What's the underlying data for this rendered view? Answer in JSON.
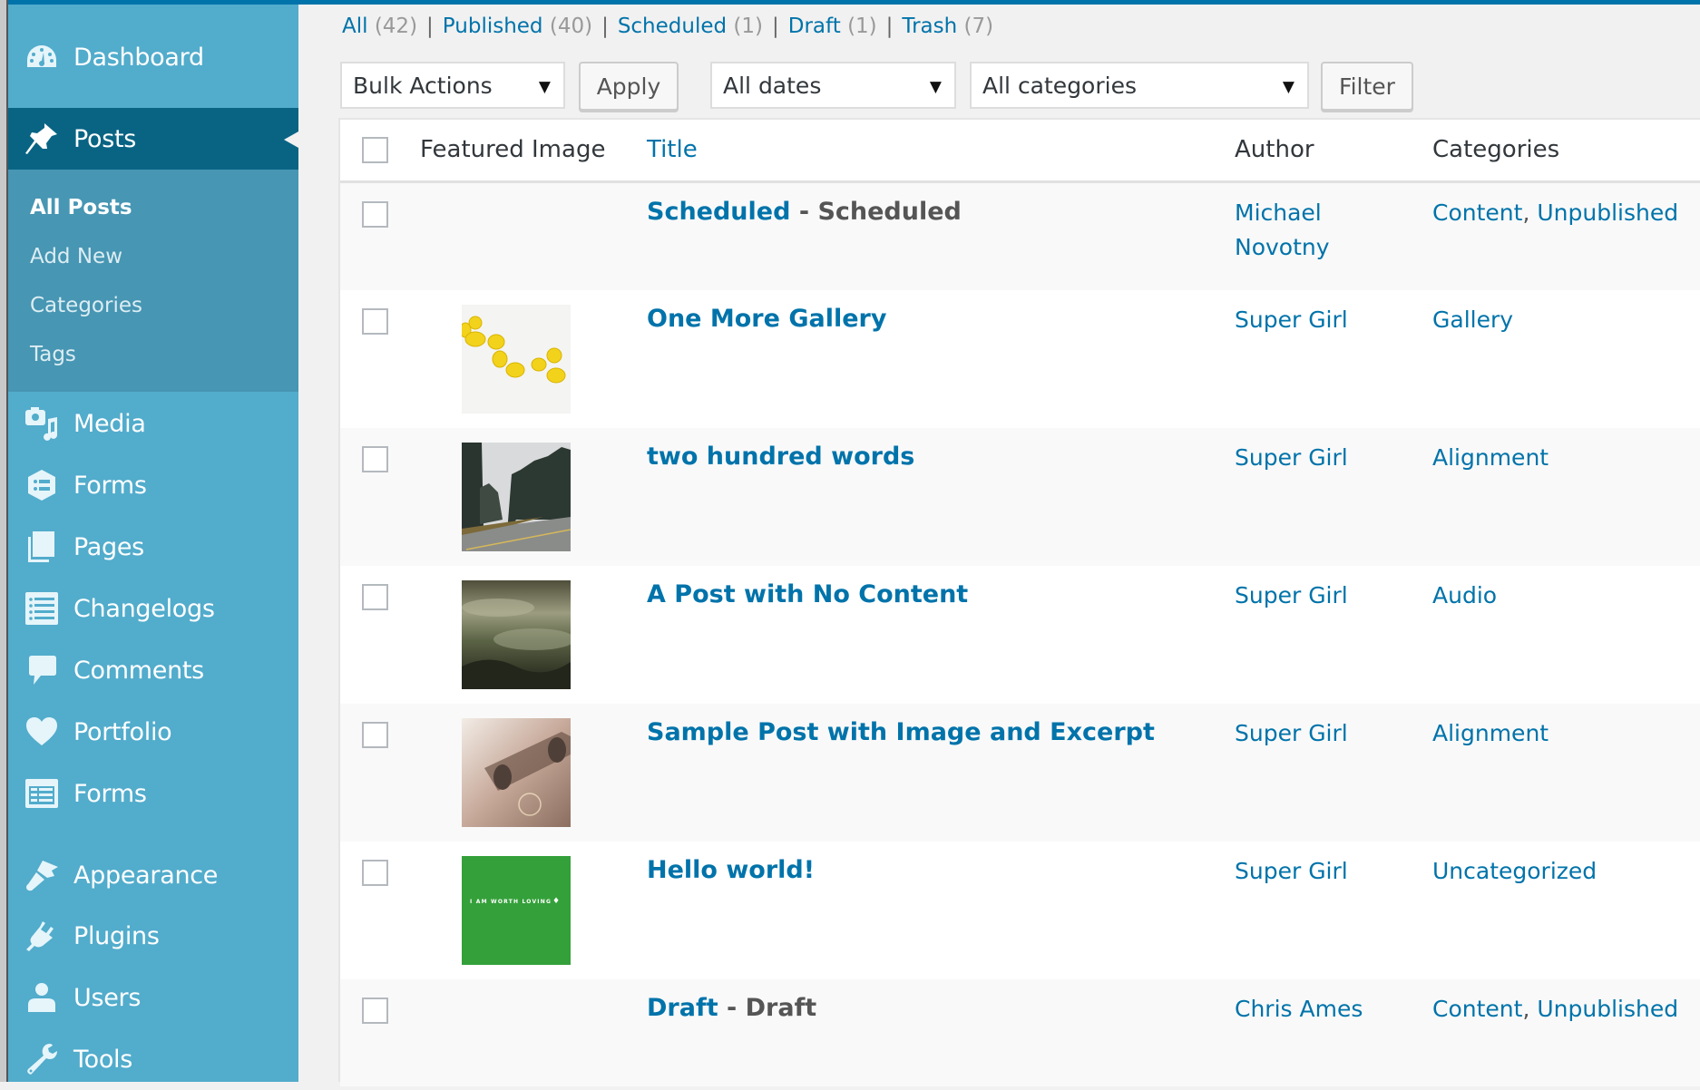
{
  "sidebar": {
    "menu": [
      {
        "label": "Dashboard",
        "icon": "dashboard-icon"
      },
      {
        "label": "Posts",
        "icon": "pushpin-icon",
        "current": true
      },
      {
        "label": "Media",
        "icon": "media-icon"
      },
      {
        "label": "Forms",
        "icon": "forms-hexagon-icon"
      },
      {
        "label": "Pages",
        "icon": "pages-icon"
      },
      {
        "label": "Changelogs",
        "icon": "list-icon"
      },
      {
        "label": "Comments",
        "icon": "comment-bubble-icon"
      },
      {
        "label": "Portfolio",
        "icon": "heart-icon"
      },
      {
        "label": "Forms",
        "icon": "forms-table-icon"
      },
      {
        "label": "Appearance",
        "icon": "paintbrush-icon"
      },
      {
        "label": "Plugins",
        "icon": "plug-icon"
      },
      {
        "label": "Users",
        "icon": "user-icon"
      },
      {
        "label": "Tools",
        "icon": "wrench-icon"
      }
    ],
    "submenu": [
      {
        "label": "All Posts",
        "current": true
      },
      {
        "label": "Add New"
      },
      {
        "label": "Categories"
      },
      {
        "label": "Tags"
      }
    ]
  },
  "views": [
    {
      "label": "All",
      "count": "(42)"
    },
    {
      "label": "Published",
      "count": "(40)"
    },
    {
      "label": "Scheduled",
      "count": "(1)"
    },
    {
      "label": "Draft",
      "count": "(1)"
    },
    {
      "label": "Trash",
      "count": "(7)"
    }
  ],
  "views_separator": "|",
  "controls": {
    "bulk_actions": "Bulk Actions",
    "apply": "Apply",
    "dates": "All dates",
    "categories": "All categories",
    "filter": "Filter",
    "caret": "▼"
  },
  "table": {
    "headers": {
      "featured_image": "Featured Image",
      "title": "Title",
      "author": "Author",
      "categories": "Categories"
    },
    "rows": [
      {
        "title": "Scheduled",
        "state": " - Scheduled",
        "thumb": "",
        "author": "Michael Novotny",
        "categories": [
          "Content",
          "Unpublished"
        ]
      },
      {
        "title": "One More Gallery",
        "state": "",
        "thumb": "lemons",
        "author": "Super Girl",
        "categories": [
          "Gallery"
        ]
      },
      {
        "title": "two hundred words",
        "state": "",
        "thumb": "forest-road",
        "author": "Super Girl",
        "categories": [
          "Alignment"
        ]
      },
      {
        "title": "A Post with No Content",
        "state": "",
        "thumb": "foggy-landscape",
        "author": "Super Girl",
        "categories": [
          "Audio"
        ]
      },
      {
        "title": "Sample Post with Image and Excerpt",
        "state": "",
        "thumb": "skateboard",
        "author": "Super Girl",
        "categories": [
          "Alignment"
        ]
      },
      {
        "title": "Hello world!",
        "state": "",
        "thumb": "green-quote",
        "thumb_text": "I AM WORTH LOVING",
        "author": "Super Girl",
        "categories": [
          "Uncategorized"
        ]
      },
      {
        "title": "Draft",
        "state": " - Draft",
        "thumb": "",
        "author": "Chris Ames",
        "categories": [
          "Content",
          "Unpublished"
        ]
      }
    ],
    "category_separator": ","
  },
  "colors": {
    "admin_bar": "#0073aa",
    "sidebar_bg": "#52accc",
    "sidebar_current": "#096484",
    "submenu_bg": "#4796b3",
    "link": "#0073aa",
    "page_bg": "#f1f1f1"
  }
}
